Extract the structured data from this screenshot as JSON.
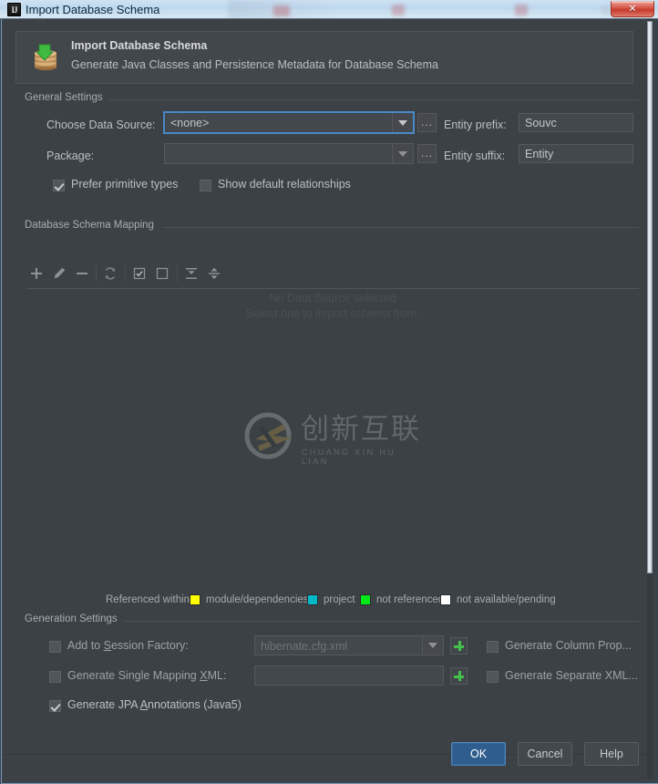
{
  "window": {
    "title": "Import Database Schema",
    "app_icon": "intellij-idea-icon",
    "close_label": "✕"
  },
  "banner": {
    "icon": "database-import-icon",
    "title": "Import Database Schema",
    "subtitle": "Generate Java Classes and Persistence Metadata for Database Schema"
  },
  "general_settings": {
    "group_label": "General Settings",
    "data_source_label": "Choose Data Source:",
    "data_source_value": "<none>",
    "package_label": "Package:",
    "package_value": "",
    "browse_label": "...",
    "entity_prefix_label": "Entity prefix:",
    "entity_prefix_value": "Souvc",
    "entity_suffix_label": "Entity suffix:",
    "entity_suffix_value": "Entity",
    "prefer_primitive_types": "Prefer primitive types",
    "show_default_relationships": "Show default relationships"
  },
  "mapping": {
    "group_label": "Database Schema Mapping",
    "toolbar": [
      {
        "name": "add-icon",
        "label": "Add"
      },
      {
        "name": "edit-pencil-icon",
        "label": "Edit"
      },
      {
        "name": "remove-icon",
        "label": "Remove"
      },
      {
        "name": "refresh-icon",
        "label": "Refresh"
      },
      {
        "name": "select-all-icon",
        "label": "Select All"
      },
      {
        "name": "deselect-all-icon",
        "label": "Deselect All"
      },
      {
        "name": "expand-all-icon",
        "label": "Expand All"
      },
      {
        "name": "collapse-all-icon",
        "label": "Collapse All"
      }
    ],
    "empty_line1": "No Data Source selected",
    "empty_line2": "Select one to import schema from."
  },
  "watermark": {
    "chinese": "创新互联",
    "pinyin": "CHUANG XIN HU LIAN",
    "logo": "cx-circle-logo"
  },
  "legend": {
    "prefix": "Referenced within:",
    "items": [
      {
        "color": "#ffff00",
        "label": "module/dependencies"
      },
      {
        "color": "#00b9c8",
        "label": "project"
      },
      {
        "color": "#00e815",
        "label": "not referenced"
      },
      {
        "color": "#ffffff",
        "label": "not available/pending"
      }
    ]
  },
  "generation_settings": {
    "group_label": "Generation Settings",
    "add_to_session_factory": "Add to Session Factory:",
    "session_factory_value": "hibernate.cfg.xml",
    "generate_single_mapping_xml": "Generate Single Mapping XML:",
    "single_mapping_value": "",
    "generate_jpa_annotations": "Generate JPA Annotations (Java5)",
    "generate_column_properties": "Generate Column Prop...",
    "generate_separate_xml": "Generate Separate XML...",
    "add_button_label": "+"
  },
  "buttons": {
    "ok": "OK",
    "cancel": "Cancel",
    "help": "Help"
  },
  "colors": {
    "dialog_bg": "#3c4145",
    "accent_blue": "#4a88c7",
    "primary_button": "#2f5d8e",
    "green": "#43c14a"
  }
}
